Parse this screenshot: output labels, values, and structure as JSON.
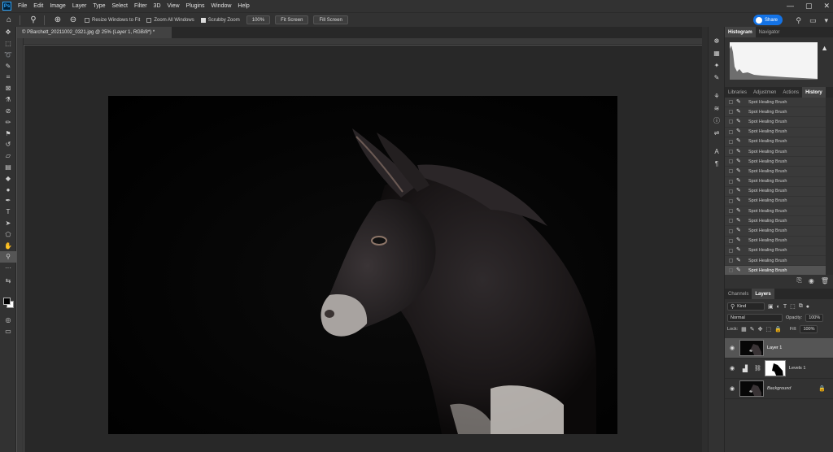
{
  "app": {
    "logo": "Ps"
  },
  "menu": [
    "File",
    "Edit",
    "Image",
    "Layer",
    "Type",
    "Select",
    "Filter",
    "3D",
    "View",
    "Plugins",
    "Window",
    "Help"
  ],
  "window_controls": {
    "minimize": "—",
    "maximize": "▢",
    "close": "✕"
  },
  "options": {
    "resize_windows": "Resize Windows to Fit",
    "zoom_all": "Zoom All Windows",
    "scrubby_zoom": "Scrubby Zoom",
    "zoom_value": "100%",
    "fit_screen": "Fit Screen",
    "fill_screen": "Fill Screen",
    "share": "Share"
  },
  "document": {
    "tab_title": "© PBarchett_20211002_0321.jpg @ 25% (Layer 1, RGB/8*) *"
  },
  "panels": {
    "top_tabs": [
      "Histogram",
      "Navigator"
    ],
    "mid_tabs": [
      "Libraries",
      "Adjustmen",
      "Actions",
      "History"
    ],
    "history_items": [
      "Spot Healing Brush",
      "Spot Healing Brush",
      "Spot Healing Brush",
      "Spot Healing Brush",
      "Spot Healing Brush",
      "Spot Healing Brush",
      "Spot Healing Brush",
      "Spot Healing Brush",
      "Spot Healing Brush",
      "Spot Healing Brush",
      "Spot Healing Brush",
      "Spot Healing Brush",
      "Spot Healing Brush",
      "Spot Healing Brush",
      "Spot Healing Brush",
      "Spot Healing Brush",
      "Spot Healing Brush",
      "Spot Healing Brush"
    ],
    "layers_tabs": [
      "Channels",
      "Layers"
    ],
    "kind_filter": "Kind",
    "blend_mode": "Normal",
    "opacity_label": "Opacity:",
    "opacity_value": "100%",
    "lock_label": "Lock:",
    "fill_label": "Fill:",
    "fill_value": "100%",
    "layers": [
      {
        "name": "Layer 1",
        "selected": true
      },
      {
        "name": "Levels 1",
        "selected": false
      },
      {
        "name": "Background",
        "selected": false
      }
    ]
  }
}
